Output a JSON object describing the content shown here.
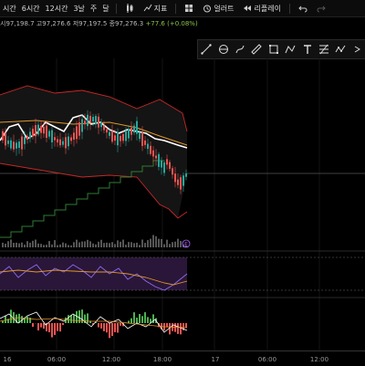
{
  "toolbar": {
    "timeframes": [
      "시간",
      "6시간",
      "12시간",
      "3날",
      "주",
      "달"
    ],
    "indicators_label": "지표",
    "alert_label": "얼러트",
    "replay_label": "리플레이"
  },
  "ohlc": {
    "open": "시97,198.7",
    "high": "고97,276.6",
    "low": "저97,197.5",
    "close": "종97,276.3",
    "change": "+77.6 (+0.08%)"
  },
  "draw_tools": [
    "line-tool-icon",
    "circle-tool-icon",
    "brush-tool-icon",
    "measure-tool-icon",
    "rectangle-tool-icon",
    "path-tool-icon",
    "text-tool-icon",
    "fibonacci-tool-icon",
    "pattern-tool-icon",
    "more-tools-icon"
  ],
  "x_axis": {
    "labels": [
      "16",
      "06:00",
      "12:00",
      "18:00",
      "17",
      "06:00",
      "12:00"
    ]
  },
  "event_marker": "E",
  "colors": {
    "up": "#26a69a",
    "down": "#ef5350",
    "bollinger": "#c62828",
    "ma_white": "#ffffff",
    "ma_orange": "#e0962c",
    "step_line": "#2e7d32",
    "rsi_band": "#2a1638",
    "rsi_line": "#8d6cf0",
    "rsi_signal": "#e0962c"
  }
}
